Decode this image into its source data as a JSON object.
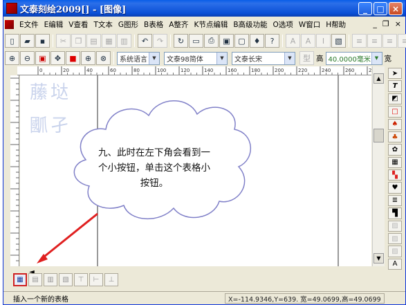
{
  "window": {
    "title": "文泰刻绘2009[] - [图像]"
  },
  "menubar": {
    "items": [
      "E文件",
      "E编辑",
      "V查看",
      "T文本",
      "G图形",
      "B表格",
      "A整齐",
      "K节点编辑",
      "B高级功能",
      "O选项",
      "W窗口",
      "H帮助"
    ]
  },
  "toolbar2": {
    "language_combo": "系统语言",
    "font_combo": "文泰98简体",
    "style_combo": "文泰长宋",
    "height_label": "高",
    "height_value": "40.0000毫米",
    "width_label": "宽"
  },
  "ruler": {
    "h_labels": [
      "0",
      "20",
      "40",
      "60",
      "80",
      "100",
      "120",
      "140",
      "160",
      "180",
      "200",
      "220",
      "240",
      "260",
      "280"
    ]
  },
  "callout": {
    "text": "九、此时在左下角会看到一个小按钮，单击这个表格小按钮。"
  },
  "statusbar": {
    "message": "插入一个新的表格",
    "coords": "X=-114.9346,Y=639.   宽=49.0699,高=49.0699"
  },
  "colors": {
    "titlebar": "#0a5ee8",
    "arrow": "#e02020",
    "cloud_outline": "#8080c8"
  }
}
